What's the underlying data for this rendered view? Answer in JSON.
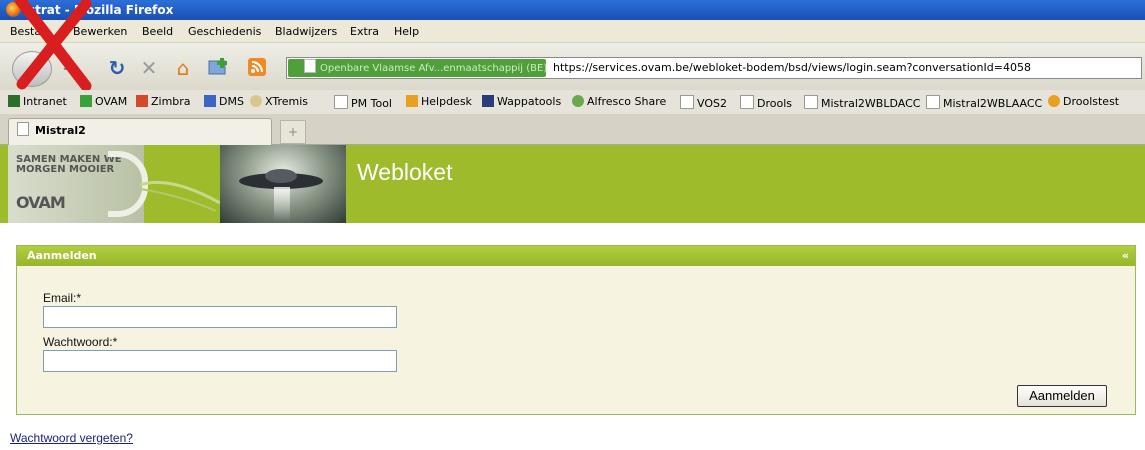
{
  "window": {
    "title": "strat - Mozilla Firefox"
  },
  "menu": [
    {
      "label": "Bestan"
    },
    {
      "label": "Bewerken"
    },
    {
      "label": "Beeld"
    },
    {
      "label": "Geschiedenis"
    },
    {
      "label": "Bladwijzers"
    },
    {
      "label": "Extra"
    },
    {
      "label": "Help"
    }
  ],
  "nav": {
    "identity_label": "Openbare Vlaamse Afv...enmaatschappij (BE)",
    "url": "https://services.ovam.be/webloket-bodem/bsd/views/login.seam?conversationId=4058"
  },
  "bookmarks": [
    {
      "label": "Intranet",
      "color": "#2c6e2c"
    },
    {
      "label": "OVAM",
      "color": "#3aa03a"
    },
    {
      "label": "Zimbra",
      "color": "#d24a2a"
    },
    {
      "label": "DMS",
      "color": "#3b66c4"
    },
    {
      "label": "XTremis",
      "color": "#b89a40"
    },
    {
      "label": "PM Tool",
      "color": "#ffffff"
    },
    {
      "label": "Helpdesk",
      "color": "#e8a020"
    },
    {
      "label": "Wappatools",
      "color": "#2a3d7a"
    },
    {
      "label": "Alfresco Share",
      "color": "#6aa84f"
    },
    {
      "label": "VOS2",
      "color": "#ffffff"
    },
    {
      "label": "Drools",
      "color": "#ffffff"
    },
    {
      "label": "Mistral2WBLDACC",
      "color": "#ffffff"
    },
    {
      "label": "Mistral2WBLAACC",
      "color": "#ffffff"
    },
    {
      "label": "Droolstest",
      "color": "#e8a020"
    }
  ],
  "tabs": [
    {
      "label": "Mistral2"
    }
  ],
  "newtab_label": "+",
  "header": {
    "logo_line1": "SAMEN MAKEN WE",
    "logo_line2": "MORGEN MOOIER",
    "logo_brand": "OVAM",
    "app_title": "Webloket"
  },
  "login": {
    "panel_title": "Aanmelden",
    "collapse_label": "«",
    "email_label": "Email:*",
    "email_value": "",
    "password_label": "Wachtwoord:*",
    "password_value": "",
    "submit_label": "Aanmelden",
    "forgot_link": "Wachtwoord vergeten?"
  },
  "colors": {
    "accent_green": "#9dbb2b",
    "panel_bg": "#f6f4e0",
    "link": "#1a237e"
  }
}
